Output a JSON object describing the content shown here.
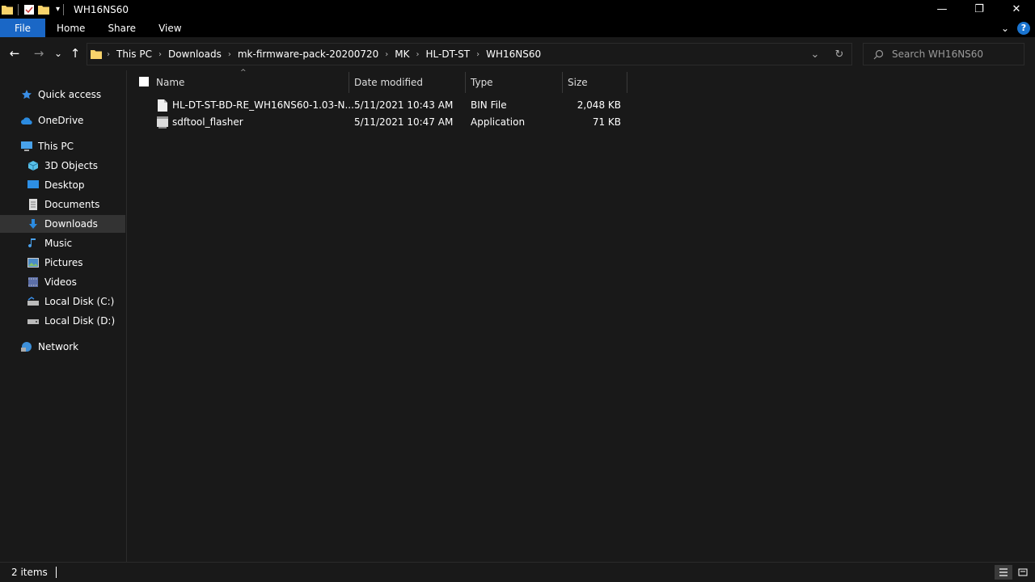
{
  "window": {
    "title": "WH16NS60",
    "controls": {
      "minimize": "—",
      "restore": "❐",
      "close": "✕"
    }
  },
  "ribbon": {
    "tabs": [
      "File",
      "Home",
      "Share",
      "View"
    ]
  },
  "nav": {
    "back": "←",
    "forward": "→",
    "recent": "⌄",
    "up": "↑"
  },
  "address": {
    "breadcrumbs": [
      "This PC",
      "Downloads",
      "mk-firmware-pack-20200720",
      "MK",
      "HL-DT-ST",
      "WH16NS60"
    ]
  },
  "search": {
    "placeholder": "Search WH16NS60"
  },
  "sidebar": {
    "items": [
      {
        "label": "Quick access",
        "icon": "star-icon"
      },
      {
        "label": "OneDrive",
        "icon": "cloud-icon"
      },
      {
        "label": "This PC",
        "icon": "computer-icon"
      },
      {
        "label": "3D Objects",
        "icon": "cube-icon"
      },
      {
        "label": "Desktop",
        "icon": "desktop-icon"
      },
      {
        "label": "Documents",
        "icon": "document-icon"
      },
      {
        "label": "Downloads",
        "icon": "download-icon"
      },
      {
        "label": "Music",
        "icon": "music-icon"
      },
      {
        "label": "Pictures",
        "icon": "picture-icon"
      },
      {
        "label": "Videos",
        "icon": "video-icon"
      },
      {
        "label": "Local Disk (C:)",
        "icon": "drive-icon"
      },
      {
        "label": "Local Disk (D:)",
        "icon": "drive-icon"
      },
      {
        "label": "Network",
        "icon": "network-icon"
      }
    ],
    "selected": "Downloads"
  },
  "columns": {
    "name": "Name",
    "date": "Date modified",
    "type": "Type",
    "size": "Size"
  },
  "files": [
    {
      "name": "HL-DT-ST-BD-RE_WH16NS60-1.03-N...",
      "date": "5/11/2021 10:43 AM",
      "type": "BIN File",
      "size": "2,048 KB",
      "icon": "file-icon"
    },
    {
      "name": "sdftool_flasher",
      "date": "5/11/2021 10:47 AM",
      "type": "Application",
      "size": "71 KB",
      "icon": "application-icon"
    }
  ],
  "status": {
    "items_count": "2 items"
  },
  "colors": {
    "accent": "#1a67c6",
    "background": "#191919",
    "selected": "#333333"
  }
}
